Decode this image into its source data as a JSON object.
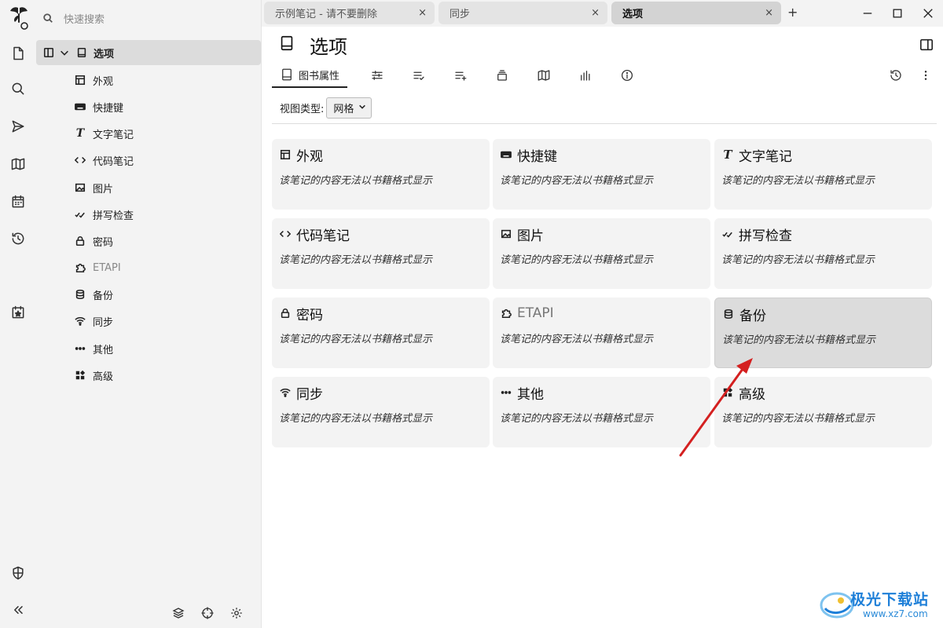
{
  "launcher": {
    "icons": [
      "app-logo-icon",
      "new-note-icon",
      "search-icon",
      "send-icon",
      "map-icon",
      "calendar-icon",
      "history-icon",
      "bookmark-calendar-icon",
      "shield-icon",
      "collapse-icon"
    ]
  },
  "sidebar": {
    "search_placeholder": "快速搜索",
    "root": {
      "label": "选项"
    },
    "items": [
      {
        "label": "外观",
        "icon": "layout-icon"
      },
      {
        "label": "快捷键",
        "icon": "keyboard-icon"
      },
      {
        "label": "文字笔记",
        "icon": "text-icon"
      },
      {
        "label": "代码笔记",
        "icon": "code-icon"
      },
      {
        "label": "图片",
        "icon": "image-icon"
      },
      {
        "label": "拼写检查",
        "icon": "spellcheck-icon"
      },
      {
        "label": "密码",
        "icon": "lock-icon"
      },
      {
        "label": "ETAPI",
        "icon": "puzzle-icon"
      },
      {
        "label": "备份",
        "icon": "database-icon"
      },
      {
        "label": "同步",
        "icon": "wifi-icon"
      },
      {
        "label": "其他",
        "icon": "dots-icon"
      },
      {
        "label": "高级",
        "icon": "grid-icon"
      }
    ]
  },
  "tabs": [
    {
      "label": "示例笔记 - 请不要删除",
      "close": "×"
    },
    {
      "label": "同步",
      "close": "×"
    },
    {
      "label": "选项",
      "close": "×"
    }
  ],
  "tab_add": "+",
  "note": {
    "title": "选项",
    "ribbon_active_label": "图书属性",
    "view_type_label": "视图类型:",
    "view_type_value": "网格"
  },
  "cards": [
    {
      "title": "外观",
      "desc": "该笔记的内容无法以书籍格式显示"
    },
    {
      "title": "快捷键",
      "desc": "该笔记的内容无法以书籍格式显示"
    },
    {
      "title": "文字笔记",
      "desc": "该笔记的内容无法以书籍格式显示"
    },
    {
      "title": "代码笔记",
      "desc": "该笔记的内容无法以书籍格式显示"
    },
    {
      "title": "图片",
      "desc": "该笔记的内容无法以书籍格式显示"
    },
    {
      "title": "拼写检查",
      "desc": "该笔记的内容无法以书籍格式显示"
    },
    {
      "title": "密码",
      "desc": "该笔记的内容无法以书籍格式显示"
    },
    {
      "title": "ETAPI",
      "desc": "该笔记的内容无法以书籍格式显示"
    },
    {
      "title": "备份",
      "desc": "该笔记的内容无法以书籍格式显示"
    },
    {
      "title": "同步",
      "desc": "该笔记的内容无法以书籍格式显示"
    },
    {
      "title": "其他",
      "desc": "该笔记的内容无法以书籍格式显示"
    },
    {
      "title": "高级",
      "desc": "该笔记的内容无法以书籍格式显示"
    }
  ],
  "watermark": {
    "title": "极光下载站",
    "url": "www.xz7.com"
  },
  "colors": {
    "annotation_arrow": "#d42020",
    "watermark": "#1e7fd8",
    "hover_card": "#dcdcdc"
  }
}
